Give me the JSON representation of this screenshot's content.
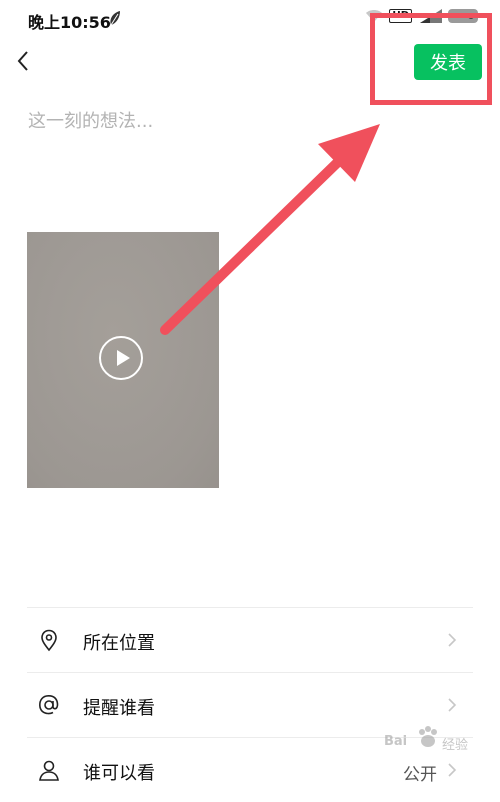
{
  "status_bar": {
    "time": "晚上10:56",
    "hd_label": "HD",
    "icons": [
      "leaf-icon",
      "wifi-icon",
      "hd-icon",
      "signal-icon",
      "battery-icon"
    ]
  },
  "header": {
    "back_icon": "chevron-left-icon",
    "publish_label": "发表",
    "publish_color": "#07c160"
  },
  "composer": {
    "placeholder": "这一刻的想法..."
  },
  "media": {
    "type": "video",
    "play_icon": "play-icon"
  },
  "menu": {
    "items": [
      {
        "icon": "location-pin-icon",
        "label": "所在位置",
        "value": ""
      },
      {
        "icon": "at-icon",
        "label": "提醒谁看",
        "value": ""
      },
      {
        "icon": "person-icon",
        "label": "谁可以看",
        "value": "公开"
      }
    ]
  },
  "annotation": {
    "color": "#f0505c",
    "highlight": "publish-button",
    "arrow_icon": "arrow-icon"
  },
  "watermark": {
    "brand_left": "Bai",
    "brand_right": "经验"
  }
}
